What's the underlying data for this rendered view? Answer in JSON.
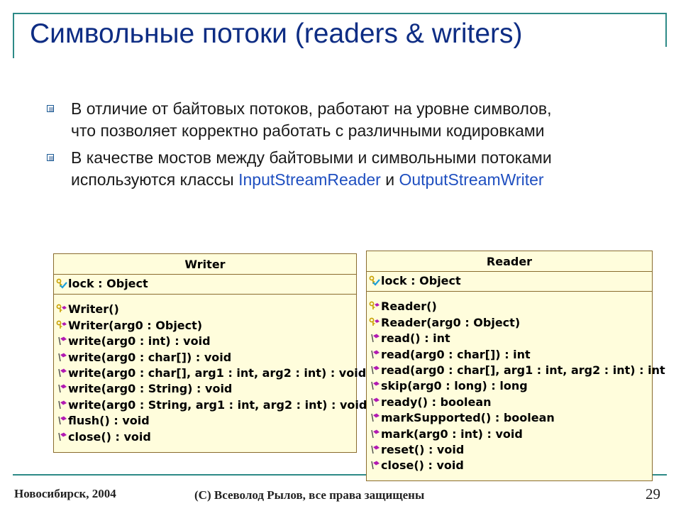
{
  "slide": {
    "title": "Символьные потоки (readers & writers)",
    "bullets": [
      {
        "line1": "В отличие от байтовых потоков, работают на уровне символов,",
        "line2": "что позволяет корректно работать с различными кодировками"
      },
      {
        "line1": "В качестве мостов между байтовыми и символьными потоками",
        "line2_prefix": "используются классы ",
        "class1": "InputStreamReader",
        "conj": " и ",
        "class2": "OutputStreamWriter"
      }
    ]
  },
  "diagram": {
    "writer": {
      "name": "Writer",
      "attributes": [
        "lock : Object"
      ],
      "operations": [
        {
          "text": "Writer()",
          "icon": "constructor-icon"
        },
        {
          "text": "Writer(arg0 : Object)",
          "icon": "constructor-icon"
        },
        {
          "text": "write(arg0 : int) : void",
          "icon": "method-icon"
        },
        {
          "text": "write(arg0 : char[]) : void",
          "icon": "method-icon"
        },
        {
          "text": "write(arg0 : char[], arg1 : int, arg2 : int) : void",
          "icon": "method-icon"
        },
        {
          "text": "write(arg0 : String) : void",
          "icon": "method-icon"
        },
        {
          "text": "write(arg0 : String, arg1 : int, arg2 : int) : void",
          "icon": "method-icon"
        },
        {
          "text": "flush() : void",
          "icon": "method-icon"
        },
        {
          "text": "close() : void",
          "icon": "method-icon"
        }
      ]
    },
    "reader": {
      "name": "Reader",
      "attributes": [
        "lock : Object"
      ],
      "operations": [
        {
          "text": "Reader()",
          "icon": "constructor-icon"
        },
        {
          "text": "Reader(arg0 : Object)",
          "icon": "constructor-icon"
        },
        {
          "text": "read() : int",
          "icon": "method-icon"
        },
        {
          "text": "read(arg0 : char[]) : int",
          "icon": "method-icon"
        },
        {
          "text": "read(arg0 : char[], arg1 : int, arg2 : int) : int",
          "icon": "method-icon"
        },
        {
          "text": "skip(arg0 : long) : long",
          "icon": "method-icon"
        },
        {
          "text": "ready() : boolean",
          "icon": "method-icon"
        },
        {
          "text": "markSupported() : boolean",
          "icon": "method-icon"
        },
        {
          "text": "mark(arg0 : int) : void",
          "icon": "method-icon"
        },
        {
          "text": "reset() : void",
          "icon": "method-icon"
        },
        {
          "text": "close() : void",
          "icon": "method-icon"
        }
      ]
    },
    "colors": {
      "box_fill": "#fffddc",
      "box_border": "#8a6c2e",
      "method_icon": "#b21ab2",
      "key_icon": "#c8a000",
      "attr_check": "#1a9fd8"
    }
  },
  "footer": {
    "city_year": "Новосибирск, 2004",
    "copyright": "(C) Всеволод Рылов, все права защищены",
    "page_number": "29"
  },
  "theme": {
    "title_color": "#0e2d84",
    "frame_color": "#2d8a87",
    "highlight_color": "#1f4fc0"
  }
}
